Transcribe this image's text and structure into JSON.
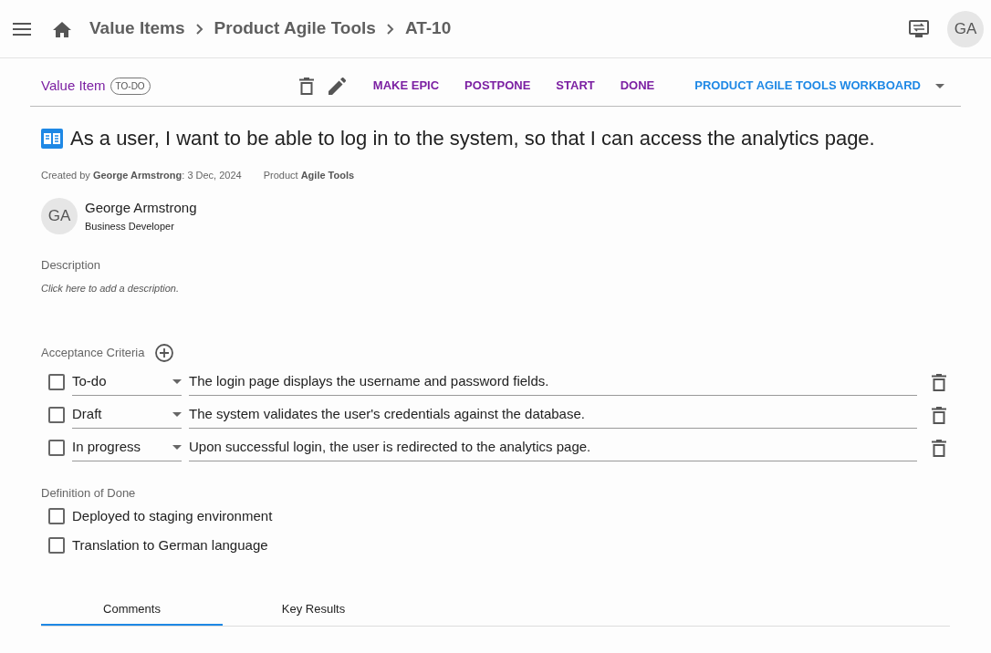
{
  "breadcrumbs": [
    "Value Items",
    "Product Agile Tools",
    "AT-10"
  ],
  "user_avatar": "GA",
  "item_type": "Value Item",
  "status_badge": "TO-DO",
  "actions": [
    {
      "label": "MAKE EPIC",
      "kind": "action"
    },
    {
      "label": "POSTPONE",
      "kind": "action"
    },
    {
      "label": "START",
      "kind": "action"
    },
    {
      "label": "DONE",
      "kind": "action"
    },
    {
      "label": "PRODUCT AGILE TOOLS WORKBOARD",
      "kind": "board"
    }
  ],
  "title": "As a user, I want to be able to log in to the system, so that I can access the analytics page.",
  "meta": {
    "created": "Created by **George Armstrong**: 3 Dec, 2024",
    "product": "Product **Agile Tools**"
  },
  "person": {
    "avatar": "GA",
    "name": "George Armstrong",
    "role": "Business Developer"
  },
  "description": {
    "label": "Description",
    "placeholder": "Click here to add a description."
  },
  "acceptance_criteria": {
    "label": "Acceptance Criteria",
    "items": [
      {
        "checked": false,
        "status": "To-do",
        "text": "The login page displays the username and password fields."
      },
      {
        "checked": false,
        "status": "Draft",
        "text": "The system validates the user's credentials against the database."
      },
      {
        "checked": false,
        "status": "In progress",
        "text": "Upon successful login, the user is redirected to the analytics page."
      }
    ]
  },
  "definition_of_done": {
    "label": "Definition of Done",
    "items": [
      {
        "checked": false,
        "text": "Deployed to staging environment"
      },
      {
        "checked": false,
        "text": "Translation to German language"
      }
    ]
  },
  "tabs": [
    {
      "label": "Comments",
      "selected": true
    },
    {
      "label": "Key Results",
      "selected": false
    }
  ]
}
